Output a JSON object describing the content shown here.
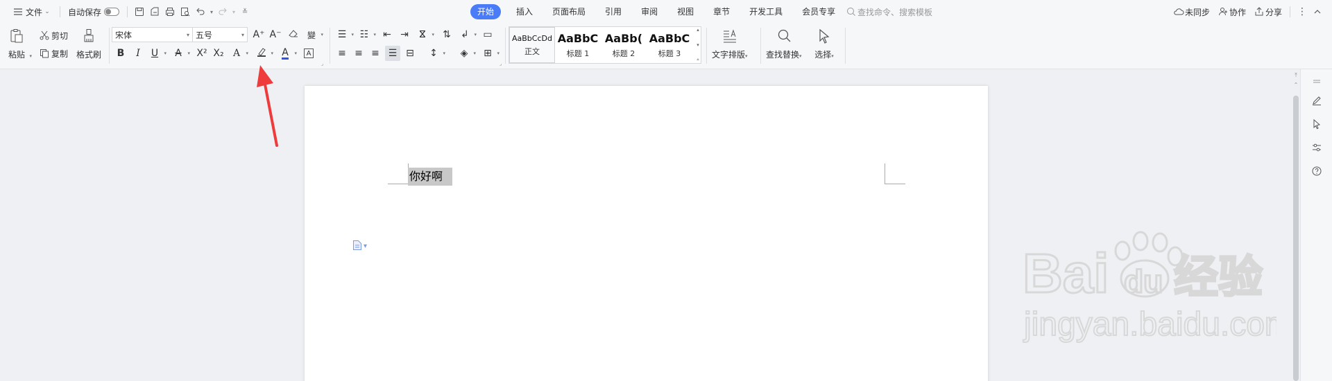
{
  "topbar": {
    "menu_label": "文件",
    "autosave_label": "自动保存",
    "tabs": [
      "开始",
      "插入",
      "页面布局",
      "引用",
      "审阅",
      "视图",
      "章节",
      "开发工具",
      "会员专享"
    ],
    "search_placeholder": "查找命令、搜索模板",
    "unsynced_label": "未同步",
    "collab_label": "协作",
    "share_label": "分享"
  },
  "ribbon": {
    "paste_label": "粘贴",
    "cut_label": "剪切",
    "copy_label": "复制",
    "format_painter_label": "格式刷",
    "font_name": "宋体",
    "font_size": "五号",
    "styles": [
      {
        "sample": "AaBbCcDd",
        "name": "正文"
      },
      {
        "sample": "AaBbC",
        "name": "标题 1"
      },
      {
        "sample": "AaBb(",
        "name": "标题 2"
      },
      {
        "sample": "AaBbC",
        "name": "标题 3"
      }
    ],
    "text_layout_label": "文字排版",
    "find_replace_label": "查找替换",
    "select_label": "选择"
  },
  "document": {
    "selected_text": "你好啊"
  },
  "colors": {
    "accent": "#4a7cf7",
    "annotation_arrow": "#ee3b3b",
    "selection": "#c8c8c8"
  },
  "watermark": {
    "brand": "Bai",
    "paw_text": "du",
    "cn": "经验",
    "url": "jingyan.baidu.com"
  }
}
